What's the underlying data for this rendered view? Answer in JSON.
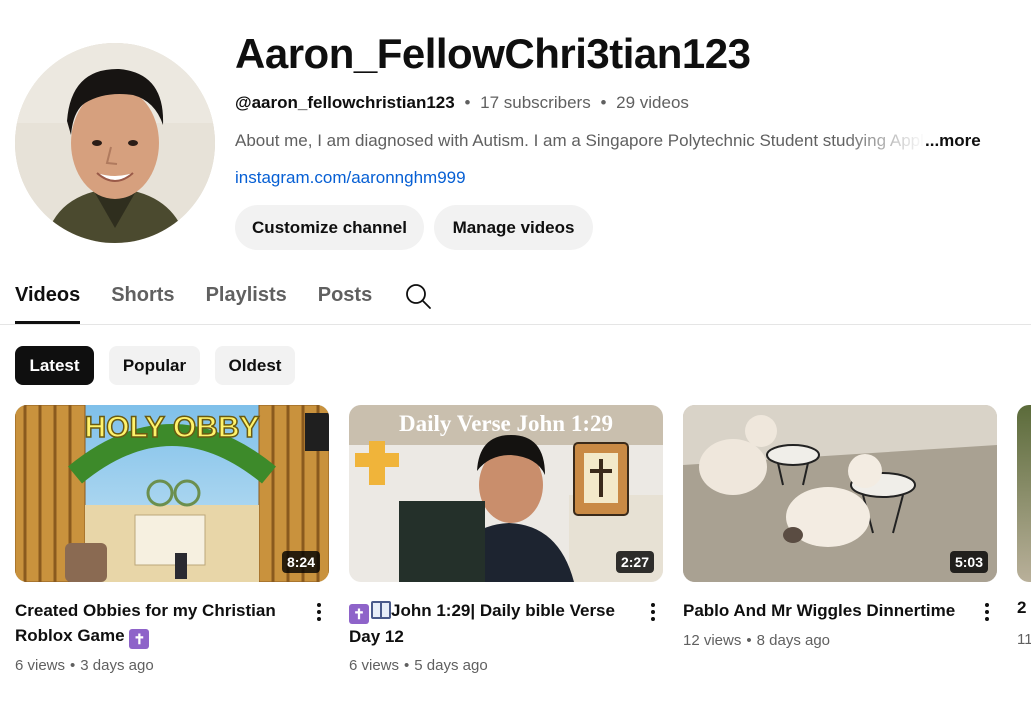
{
  "channel": {
    "name": "Aaron_FellowChri3tian123",
    "handle": "@aaron_fellowchristian123",
    "subscribers": "17 subscribers",
    "video_count": "29 videos",
    "meta_sep": "•",
    "about": "About me, I am diagnosed with Autism. I am a Singapore Polytechnic Student studying Applied",
    "more_label": "...more",
    "link": "instagram.com/aaronnghm999",
    "customize_label": "Customize channel",
    "manage_label": "Manage videos"
  },
  "tabs": [
    {
      "label": "Videos",
      "active": true
    },
    {
      "label": "Shorts",
      "active": false
    },
    {
      "label": "Playlists",
      "active": false
    },
    {
      "label": "Posts",
      "active": false
    }
  ],
  "chips": [
    {
      "label": "Latest",
      "active": true
    },
    {
      "label": "Popular",
      "active": false
    },
    {
      "label": "Oldest",
      "active": false
    }
  ],
  "videos": [
    {
      "title": "Created Obbies for my Christian Roblox Game",
      "duration": "8:24",
      "views": "6 views",
      "age": "3 days ago",
      "thumb_text": "HOLY OBBY"
    },
    {
      "title": "John 1:29| Daily bible Verse Day 12",
      "duration": "2:27",
      "views": "6 views",
      "age": "5 days ago",
      "thumb_text": "Daily Verse John 1:29"
    },
    {
      "title": "Pablo And Mr Wiggles Dinnertime",
      "duration": "5:03",
      "views": "12 views",
      "age": "8 days ago"
    }
  ],
  "partial_video": {
    "title": "2",
    "meta": "11"
  },
  "icons": {
    "search": "search-icon",
    "more": "more-vert-icon",
    "cross": "latin-cross-icon",
    "book": "open-book-icon"
  },
  "colors": {
    "link": "#065fd4",
    "chip_active_bg": "#0f0f0f",
    "chip_bg": "#f2f2f2",
    "meta_text": "#606060",
    "cross_badge": "#8e63c9"
  }
}
